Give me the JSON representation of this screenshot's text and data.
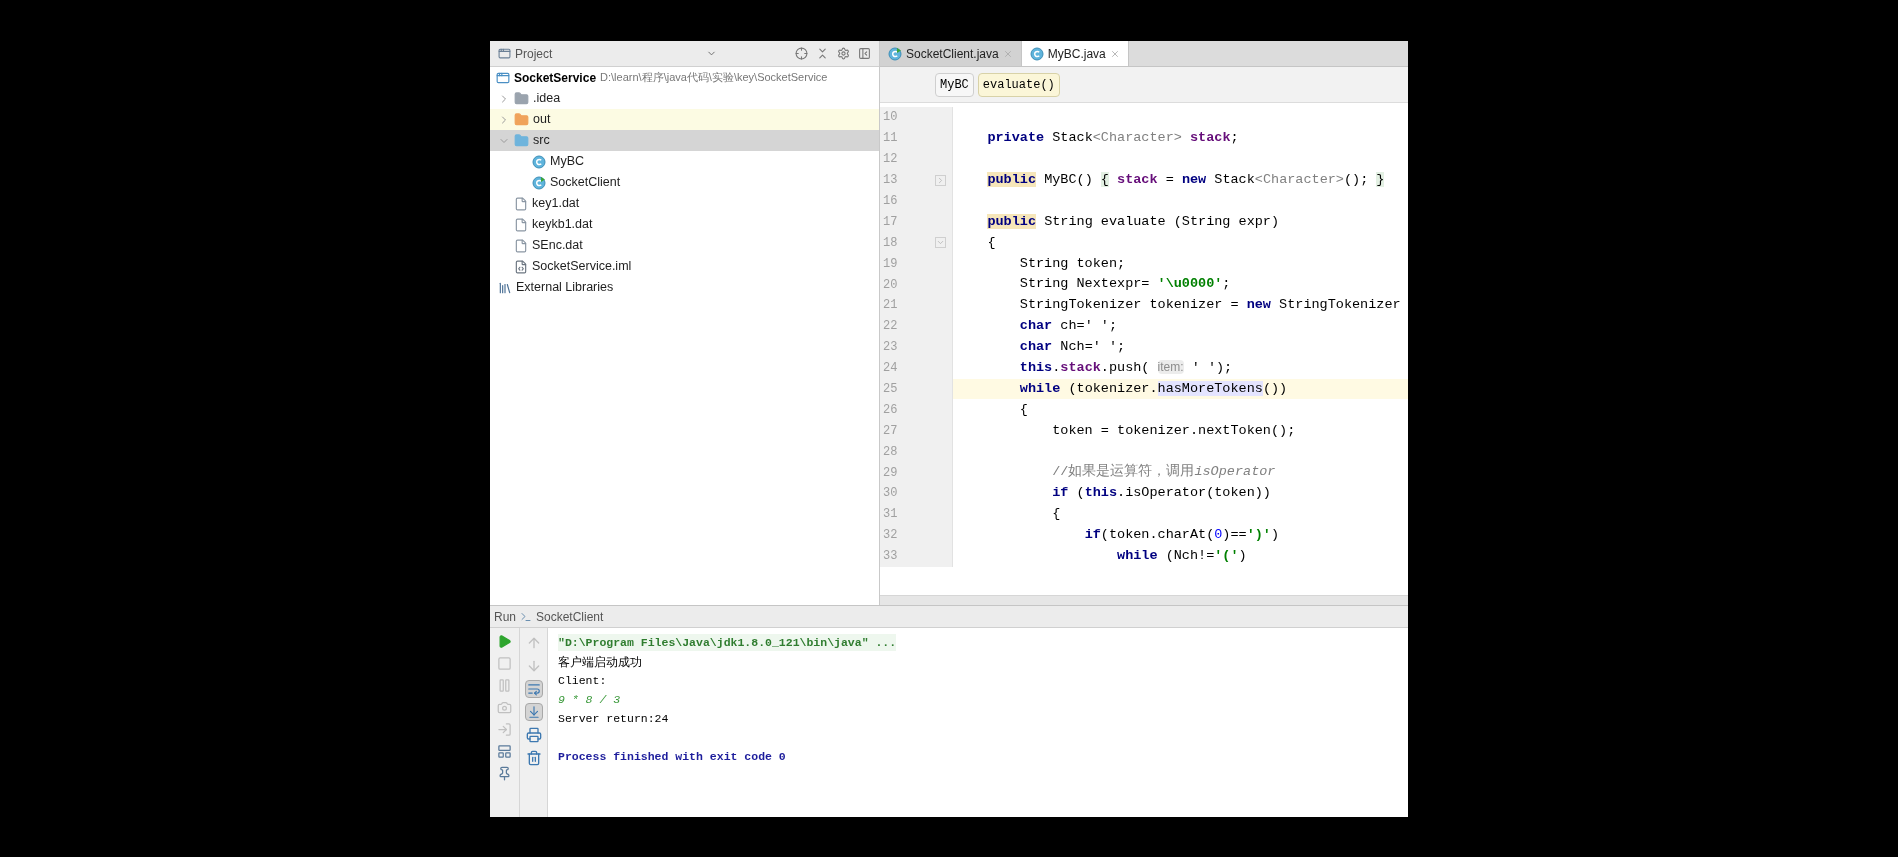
{
  "project_panel": {
    "title": "Project",
    "root": {
      "label": "SocketService",
      "path": "D:\\learn\\程序\\java代码\\实验\\key\\SocketService",
      "children": [
        {
          "label": ".idea",
          "kind": "folder",
          "color": "#9aa3ad",
          "expanded": false,
          "selected": false
        },
        {
          "label": "out",
          "kind": "folder",
          "color": "#f0a35a",
          "expanded": false,
          "selected": false,
          "hovered": true
        },
        {
          "label": "src",
          "kind": "folder",
          "color": "#6fb4dc",
          "expanded": true,
          "selected": true,
          "children": [
            {
              "label": "MyBC",
              "kind": "class",
              "selected": false
            },
            {
              "label": "SocketClient",
              "kind": "class_main",
              "selected": false
            }
          ]
        },
        {
          "label": "key1.dat",
          "kind": "data_file",
          "selected": false
        },
        {
          "label": "keykb1.dat",
          "kind": "data_file",
          "selected": false
        },
        {
          "label": "SEnc.dat",
          "kind": "data_file",
          "selected": false
        },
        {
          "label": "SocketService.iml",
          "kind": "module_file",
          "selected": false
        }
      ]
    },
    "external": "External Libraries"
  },
  "editor": {
    "tabs": [
      {
        "label": "SocketClient.java",
        "kind": "class_main",
        "selected": false
      },
      {
        "label": "MyBC.java",
        "kind": "class",
        "selected": true
      }
    ],
    "breadcrumbs": [
      {
        "label": "MyBC",
        "selected": false
      },
      {
        "label": "evaluate()",
        "selected": true
      }
    ],
    "lines": [
      {
        "number": "10",
        "current": false
      },
      {
        "number": "11",
        "current": false,
        "segments": [
          {
            "kind": "keyword",
            "text": "    private"
          },
          {
            "kind": "plain",
            "text": " Stack"
          },
          {
            "kind": "generic",
            "text": "<Character>"
          },
          {
            "kind": "field",
            "text": " stack"
          },
          {
            "kind": "plain",
            "text": ";"
          }
        ]
      },
      {
        "number": "12",
        "current": false
      },
      {
        "number": "13",
        "current": false,
        "folded": true,
        "segments": [
          {
            "kind": "keyword_marked",
            "text": "    public"
          },
          {
            "kind": "plain",
            "text": " MyBC() "
          },
          {
            "kind": "folded",
            "text": "{"
          },
          {
            "kind": "field",
            "text": " stack"
          },
          {
            "kind": "plain",
            "text": " = "
          },
          {
            "kind": "keyword",
            "text": "new"
          },
          {
            "kind": "plain",
            "text": " Stack"
          },
          {
            "kind": "generic",
            "text": "<Character>"
          },
          {
            "kind": "plain",
            "text": "(); "
          },
          {
            "kind": "folded",
            "text": "}"
          }
        ]
      },
      {
        "number": "16",
        "current": false
      },
      {
        "number": "17",
        "current": false,
        "segments": [
          {
            "kind": "keyword_marked",
            "text": "    public"
          },
          {
            "kind": "plain",
            "text": " String evaluate (String expr)"
          }
        ]
      },
      {
        "number": "18",
        "current": false,
        "folded": false,
        "segments": [
          {
            "kind": "plain",
            "text": "    {"
          }
        ]
      },
      {
        "number": "19",
        "current": false,
        "segments": [
          {
            "kind": "plain",
            "text": "        String token;"
          }
        ]
      },
      {
        "number": "20",
        "current": false,
        "segments": [
          {
            "kind": "plain",
            "text": "        String Nextexpr= "
          },
          {
            "kind": "string",
            "text": "'\\u0000'"
          },
          {
            "kind": "plain",
            "text": ";"
          }
        ]
      },
      {
        "number": "21",
        "current": false,
        "segments": [
          {
            "kind": "plain",
            "text": "        StringTokenizer tokenizer = "
          },
          {
            "kind": "keyword",
            "text": "new"
          },
          {
            "kind": "plain",
            "text": " StringTokenizer"
          }
        ]
      },
      {
        "number": "22",
        "current": false,
        "segments": [
          {
            "kind": "keyword",
            "text": "        char"
          },
          {
            "kind": "plain",
            "text": " ch=' ';"
          }
        ]
      },
      {
        "number": "23",
        "current": false,
        "segments": [
          {
            "kind": "keyword",
            "text": "        char"
          },
          {
            "kind": "plain",
            "text": " Nch=' ';"
          }
        ]
      },
      {
        "number": "24",
        "current": false,
        "segments": [
          {
            "kind": "keyword",
            "text": "        this"
          },
          {
            "kind": "plain",
            "text": "."
          },
          {
            "kind": "field",
            "text": "stack"
          },
          {
            "kind": "plain",
            "text": ".push( "
          },
          {
            "kind": "hint",
            "text": "item:"
          },
          {
            "kind": "plain",
            "text": " ' ');"
          }
        ]
      },
      {
        "number": "25",
        "current": true,
        "segments": [
          {
            "kind": "keyword",
            "text": "        while"
          },
          {
            "kind": "plain",
            "text": " (tokenizer."
          },
          {
            "kind": "match",
            "text": "hasMoreTokens"
          },
          {
            "kind": "plain",
            "text": "())"
          }
        ]
      },
      {
        "number": "26",
        "current": false,
        "segments": [
          {
            "kind": "plain",
            "text": "        {"
          }
        ]
      },
      {
        "number": "27",
        "current": false,
        "segments": [
          {
            "kind": "plain",
            "text": "            token = tokenizer.nextToken();"
          }
        ]
      },
      {
        "number": "28",
        "current": false
      },
      {
        "number": "29",
        "current": false,
        "segments": [
          {
            "kind": "comment",
            "text": "            //如果是运算符，调用"
          },
          {
            "kind": "comment_ref",
            "text": "isOperator"
          }
        ]
      },
      {
        "number": "30",
        "current": false,
        "segments": [
          {
            "kind": "keyword",
            "text": "            if"
          },
          {
            "kind": "plain",
            "text": " ("
          },
          {
            "kind": "keyword",
            "text": "this"
          },
          {
            "kind": "plain",
            "text": ".isOperator(token))"
          }
        ]
      },
      {
        "number": "31",
        "current": false,
        "segments": [
          {
            "kind": "plain",
            "text": "            {"
          }
        ]
      },
      {
        "number": "32",
        "current": false,
        "segments": [
          {
            "kind": "keyword",
            "text": "                if"
          },
          {
            "kind": "plain",
            "text": "(token.charAt("
          },
          {
            "kind": "number",
            "text": "0"
          },
          {
            "kind": "plain",
            "text": ")=="
          },
          {
            "kind": "string",
            "text": "')'"
          },
          {
            "kind": "plain",
            "text": ")"
          }
        ]
      },
      {
        "number": "33",
        "current": false,
        "segments": [
          {
            "kind": "keyword",
            "text": "                    while"
          },
          {
            "kind": "plain",
            "text": " (Nch!="
          },
          {
            "kind": "string",
            "text": "'('"
          },
          {
            "kind": "plain",
            "text": ")"
          }
        ]
      }
    ]
  },
  "run_panel": {
    "title": "Run",
    "config": "SocketClient",
    "left_toolbar": [
      {
        "kind": "run",
        "disabled": false
      },
      {
        "kind": "stop",
        "disabled": true
      },
      {
        "kind": "pause",
        "disabled": true
      },
      {
        "kind": "dump",
        "disabled": true
      },
      {
        "kind": "exit",
        "disabled": true
      },
      {
        "kind": "layout",
        "disabled": false
      },
      {
        "kind": "pin",
        "disabled": false
      }
    ],
    "right_toolbar": [
      {
        "kind": "up",
        "disabled": true,
        "on": false
      },
      {
        "kind": "down",
        "disabled": true,
        "on": false
      },
      {
        "kind": "wrap",
        "disabled": false,
        "on": true
      },
      {
        "kind": "scroll_end",
        "disabled": false,
        "on": true
      },
      {
        "kind": "print",
        "disabled": false,
        "on": false
      },
      {
        "kind": "clear",
        "disabled": false,
        "on": false
      }
    ],
    "console": [
      {
        "kind": "command",
        "text": "\"D:\\Program Files\\Java\\jdk1.8.0_121\\bin\\java\" ..."
      },
      {
        "kind": "output_cjk",
        "text": "客户端启动成功"
      },
      {
        "kind": "output",
        "text": "Client:"
      },
      {
        "kind": "input",
        "text": "9 * 8 / 3"
      },
      {
        "kind": "output",
        "text": "Server return:24"
      },
      {
        "kind": "blank"
      },
      {
        "kind": "system",
        "text": "Process finished with exit code 0"
      }
    ]
  }
}
